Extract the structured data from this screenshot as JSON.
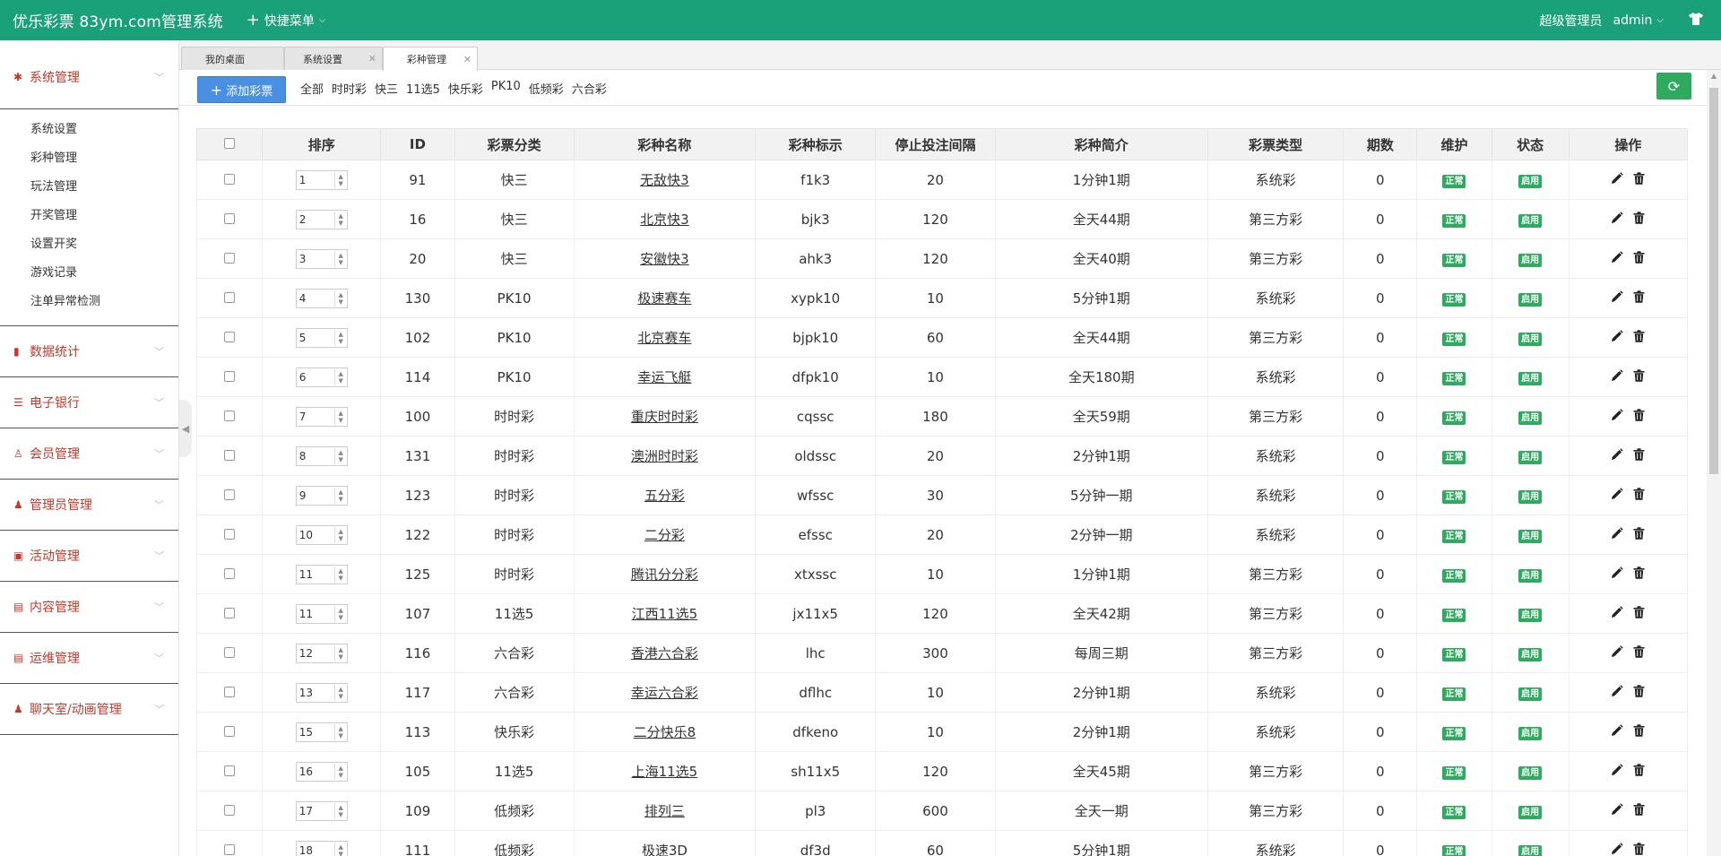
{
  "header": {
    "brand": "优乐彩票 83ym.com管理系统",
    "quick_menu": "快捷菜单",
    "role": "超级管理员",
    "user": "admin"
  },
  "sidebar": {
    "sections": [
      {
        "label": "系统管理",
        "icon": "gear-icon"
      },
      {
        "label": "数据统计",
        "icon": "bar-chart-icon"
      },
      {
        "label": "电子银行",
        "icon": "list-icon"
      },
      {
        "label": "会员管理",
        "icon": "user-outline-icon"
      },
      {
        "label": "管理员管理",
        "icon": "user-icon"
      },
      {
        "label": "活动管理",
        "icon": "gift-icon"
      },
      {
        "label": "内容管理",
        "icon": "newspaper-icon"
      },
      {
        "label": "运维管理",
        "icon": "newspaper-icon"
      },
      {
        "label": "聊天室/动画管理",
        "icon": "user-icon"
      }
    ],
    "sub_items": [
      "系统设置",
      "彩种管理",
      "玩法管理",
      "开奖管理",
      "设置开奖",
      "游戏记录",
      "注单异常检测"
    ]
  },
  "tabs": [
    {
      "label": "我的桌面"
    },
    {
      "label": "系统设置"
    },
    {
      "label": "彩种管理"
    }
  ],
  "toolbar": {
    "add_label": "添加彩票",
    "filters": [
      "全部",
      "时时彩",
      "快三",
      "11选5",
      "快乐彩",
      "PK10",
      "低频彩",
      "六合彩"
    ]
  },
  "table": {
    "columns": [
      "排序",
      "ID",
      "彩票分类",
      "彩种名称",
      "彩种标示",
      "停止投注间隔",
      "彩种简介",
      "彩票类型",
      "期数",
      "维护",
      "状态",
      "操作"
    ],
    "rows": [
      {
        "sort": "1",
        "id": "91",
        "cat": "快三",
        "name": "无敌快3",
        "code": "f1k3",
        "interval": "20",
        "desc": "1分钟1期",
        "type": "系统彩",
        "periods": "0",
        "maint": "正常",
        "status": "启用"
      },
      {
        "sort": "2",
        "id": "16",
        "cat": "快三",
        "name": "北京快3",
        "code": "bjk3",
        "interval": "120",
        "desc": "全天44期",
        "type": "第三方彩",
        "periods": "0",
        "maint": "正常",
        "status": "启用"
      },
      {
        "sort": "3",
        "id": "20",
        "cat": "快三",
        "name": "安徽快3",
        "code": "ahk3",
        "interval": "120",
        "desc": "全天40期",
        "type": "第三方彩",
        "periods": "0",
        "maint": "正常",
        "status": "启用"
      },
      {
        "sort": "4",
        "id": "130",
        "cat": "PK10",
        "name": "极速赛车",
        "code": "xypk10",
        "interval": "10",
        "desc": "5分钟1期",
        "type": "系统彩",
        "periods": "0",
        "maint": "正常",
        "status": "启用"
      },
      {
        "sort": "5",
        "id": "102",
        "cat": "PK10",
        "name": "北京赛车",
        "code": "bjpk10",
        "interval": "60",
        "desc": "全天44期",
        "type": "第三方彩",
        "periods": "0",
        "maint": "正常",
        "status": "启用"
      },
      {
        "sort": "6",
        "id": "114",
        "cat": "PK10",
        "name": "幸运飞艇",
        "code": "dfpk10",
        "interval": "10",
        "desc": "全天180期",
        "type": "系统彩",
        "periods": "0",
        "maint": "正常",
        "status": "启用"
      },
      {
        "sort": "7",
        "id": "100",
        "cat": "时时彩",
        "name": "重庆时时彩",
        "code": "cqssc",
        "interval": "180",
        "desc": "全天59期",
        "type": "第三方彩",
        "periods": "0",
        "maint": "正常",
        "status": "启用"
      },
      {
        "sort": "8",
        "id": "131",
        "cat": "时时彩",
        "name": "澳洲时时彩",
        "code": "oldssc",
        "interval": "20",
        "desc": "2分钟1期",
        "type": "系统彩",
        "periods": "0",
        "maint": "正常",
        "status": "启用"
      },
      {
        "sort": "9",
        "id": "123",
        "cat": "时时彩",
        "name": "五分彩",
        "code": "wfssc",
        "interval": "30",
        "desc": "5分钟一期",
        "type": "系统彩",
        "periods": "0",
        "maint": "正常",
        "status": "启用"
      },
      {
        "sort": "10",
        "id": "122",
        "cat": "时时彩",
        "name": "二分彩",
        "code": "efssc",
        "interval": "20",
        "desc": "2分钟一期",
        "type": "系统彩",
        "periods": "0",
        "maint": "正常",
        "status": "启用"
      },
      {
        "sort": "11",
        "id": "125",
        "cat": "时时彩",
        "name": "腾讯分分彩",
        "code": "xtxssc",
        "interval": "10",
        "desc": "1分钟1期",
        "type": "第三方彩",
        "periods": "0",
        "maint": "正常",
        "status": "启用"
      },
      {
        "sort": "11",
        "id": "107",
        "cat": "11选5",
        "name": "江西11选5",
        "code": "jx11x5",
        "interval": "120",
        "desc": "全天42期",
        "type": "第三方彩",
        "periods": "0",
        "maint": "正常",
        "status": "启用"
      },
      {
        "sort": "12",
        "id": "116",
        "cat": "六合彩",
        "name": "香港六合彩",
        "code": "lhc",
        "interval": "300",
        "desc": "每周三期",
        "type": "第三方彩",
        "periods": "0",
        "maint": "正常",
        "status": "启用"
      },
      {
        "sort": "13",
        "id": "117",
        "cat": "六合彩",
        "name": "幸运六合彩",
        "code": "dflhc",
        "interval": "10",
        "desc": "2分钟1期",
        "type": "系统彩",
        "periods": "0",
        "maint": "正常",
        "status": "启用"
      },
      {
        "sort": "15",
        "id": "113",
        "cat": "快乐彩",
        "name": "二分快乐8",
        "code": "dfkeno",
        "interval": "10",
        "desc": "2分钟1期",
        "type": "系统彩",
        "periods": "0",
        "maint": "正常",
        "status": "启用"
      },
      {
        "sort": "16",
        "id": "105",
        "cat": "11选5",
        "name": "上海11选5",
        "code": "sh11x5",
        "interval": "120",
        "desc": "全天45期",
        "type": "第三方彩",
        "periods": "0",
        "maint": "正常",
        "status": "启用"
      },
      {
        "sort": "17",
        "id": "109",
        "cat": "低频彩",
        "name": "排列三",
        "code": "pl3",
        "interval": "600",
        "desc": "全天一期",
        "type": "第三方彩",
        "periods": "0",
        "maint": "正常",
        "status": "启用"
      },
      {
        "sort": "18",
        "id": "111",
        "cat": "低频彩",
        "name": "极速3D",
        "code": "df3d",
        "interval": "60",
        "desc": "5分钟1期",
        "type": "系统彩",
        "periods": "0",
        "maint": "正常",
        "status": "启用"
      }
    ]
  },
  "colors": {
    "header": "#1aa179",
    "accent_red": "#c0392b",
    "badge": "#2eab5f",
    "primary": "#4a90e2"
  }
}
